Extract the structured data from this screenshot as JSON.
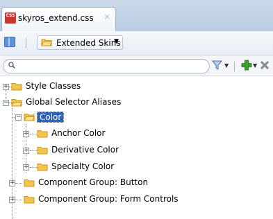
{
  "editor_tab": {
    "title": "skyros_extend.css",
    "file_icon": "css-file-icon",
    "file_icon_text": "CSS",
    "close_glyph": "×"
  },
  "toolbar": {
    "skin_dropdown_label": "Extended Skins"
  },
  "search": {
    "placeholder": "",
    "value": ""
  },
  "tree": {
    "style_classes": "Style Classes",
    "global_selector_aliases": "Global Selector Aliases",
    "color": "Color",
    "anchor_color": "Anchor Color",
    "derivative_color": "Derivative Color",
    "specialty_color": "Specialty Color",
    "component_group_button": "Component Group: Button",
    "component_group_form_controls": "Component Group: Form Controls"
  },
  "colors": {
    "selection": "#2a62c6",
    "folder": "#f4c54a",
    "add_green": "#37a12a"
  }
}
